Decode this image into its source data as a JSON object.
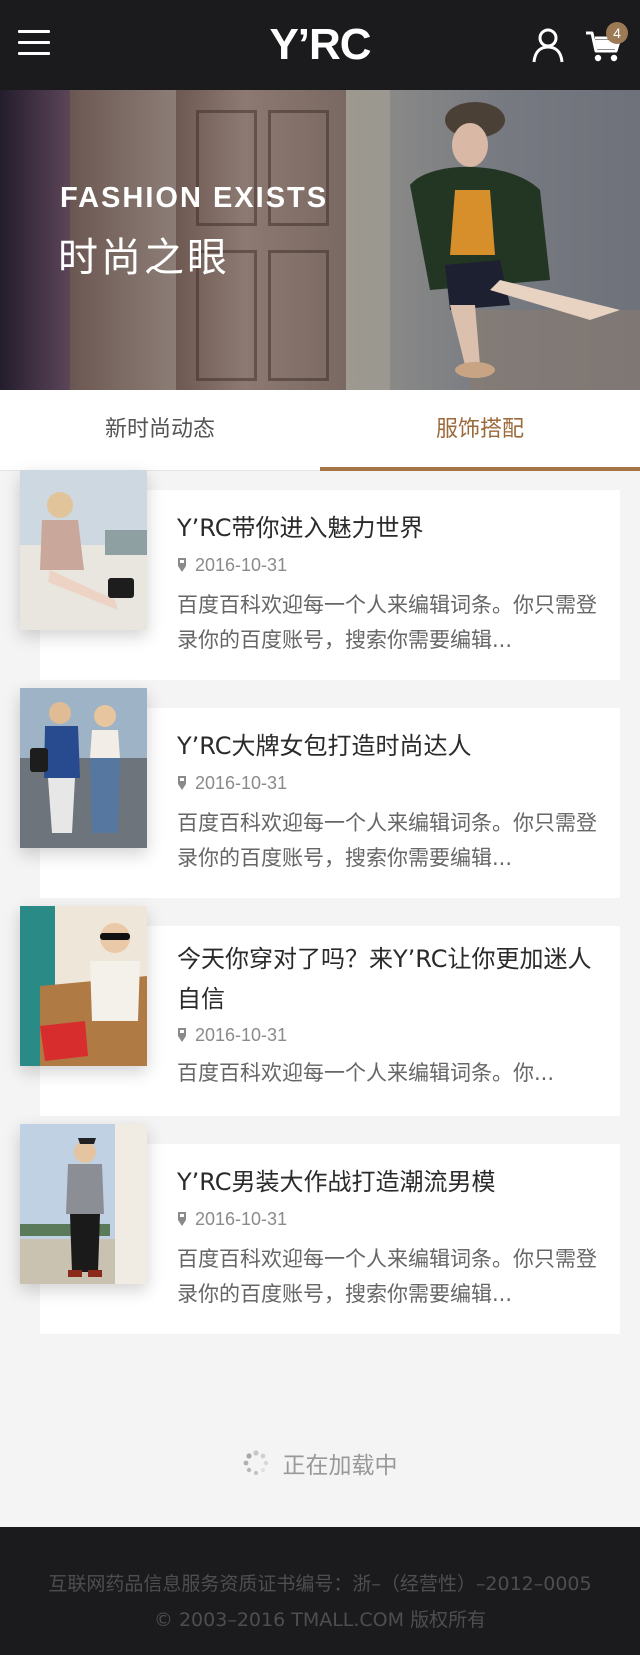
{
  "header": {
    "logo_text": "Y’RC",
    "cart_count": "4",
    "icons": [
      "menu-icon",
      "user-icon",
      "cart-icon"
    ]
  },
  "banner": {
    "title": "FASHION EXISTS",
    "subtitle": "时尚之眼"
  },
  "tabs": [
    {
      "label": "新时尚动态",
      "active": false
    },
    {
      "label": "服饰搭配",
      "active": true
    }
  ],
  "articles": [
    {
      "title": "Y’RC带你进入魅力世界",
      "date": "2016-10-31",
      "desc": "百度百科欢迎每一个人来编辑词条。你只需登录你的百度账号，搜索你需要编辑..."
    },
    {
      "title": "Y’RC大牌女包打造时尚达人",
      "date": "2016-10-31",
      "desc": "百度百科欢迎每一个人来编辑词条。你只需登录你的百度账号，搜索你需要编辑..."
    },
    {
      "title": "今天你穿对了吗？来Y’RC让你更加迷人自信",
      "date": "2016-10-31",
      "desc": "百度百科欢迎每一个人来编辑词条。你..."
    },
    {
      "title": "Y’RC男装大作战打造潮流男模",
      "date": "2016-10-31",
      "desc": "百度百科欢迎每一个人来编辑词条。你只需登录你的百度账号，搜索你需要编辑..."
    }
  ],
  "loading": {
    "text": "正在加载中"
  },
  "footer": {
    "license": "互联网药品信息服务资质证书编号：浙–（经营性）–2012–0005",
    "copyright": "© 2003–2016 TMALL.COM 版权所有"
  },
  "colors": {
    "header_bg": "#1b1b1d",
    "accent": "#a47444",
    "badge": "#9c7a55",
    "page_bg": "#f4f4f4"
  }
}
